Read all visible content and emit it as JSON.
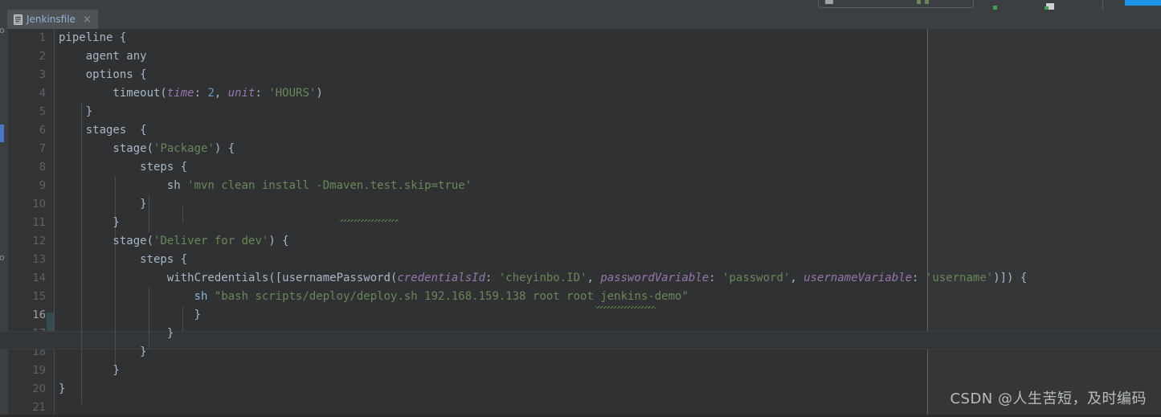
{
  "toolbar": {
    "run_config_placeholder": "",
    "icons": [
      "run-icon",
      "debug-icon",
      "settings-icon",
      "search-icon"
    ]
  },
  "tab": {
    "icon": "file-icon",
    "label": "Jenkinsfile",
    "close_label": "×"
  },
  "editor": {
    "current_line": 16,
    "line_numbers": [
      "1",
      "2",
      "3",
      "4",
      "5",
      "6",
      "7",
      "8",
      "9",
      "10",
      "11",
      "12",
      "13",
      "14",
      "15",
      "16",
      "17",
      "18",
      "19",
      "20",
      "21"
    ],
    "lines": [
      {
        "n": 1,
        "text": "pipeline {"
      },
      {
        "n": 2,
        "text": "    agent any"
      },
      {
        "n": 3,
        "text": "    options {"
      },
      {
        "n": 4,
        "text": "        timeout(time: 2, unit: 'HOURS')"
      },
      {
        "n": 5,
        "text": "    }"
      },
      {
        "n": 6,
        "text": "    stages  {"
      },
      {
        "n": 7,
        "text": "        stage('Package') {"
      },
      {
        "n": 8,
        "text": "            steps {"
      },
      {
        "n": 9,
        "text": "                sh 'mvn clean install -Dmaven.test.skip=true'"
      },
      {
        "n": 10,
        "text": "            }"
      },
      {
        "n": 11,
        "text": "        }"
      },
      {
        "n": 12,
        "text": "        stage('Deliver for dev') {"
      },
      {
        "n": 13,
        "text": "            steps {"
      },
      {
        "n": 14,
        "text": "                withCredentials([usernamePassword(credentialsId: 'cheyinbo.ID', passwordVariable: 'password', usernameVariable: 'username')]) {"
      },
      {
        "n": 15,
        "text": "                    sh \"bash scripts/deploy/deploy.sh 192.168.159.138 root root jenkins-demo\""
      },
      {
        "n": 16,
        "text": "                    }"
      },
      {
        "n": 17,
        "text": "                }"
      },
      {
        "n": 18,
        "text": "            }"
      },
      {
        "n": 19,
        "text": "        }"
      },
      {
        "n": 20,
        "text": "}"
      },
      {
        "n": 21,
        "text": ""
      }
    ],
    "tokens": {
      "line1": [
        "pipeline",
        " {"
      ],
      "line2": [
        "agent any"
      ],
      "line3": [
        "options {"
      ],
      "line4": [
        "timeout(",
        "time",
        ": ",
        "2",
        ", ",
        "unit",
        ": ",
        "'HOURS'",
        ")"
      ],
      "line6": [
        "stages  {"
      ],
      "line7": [
        "stage(",
        "'Package'",
        ") {"
      ],
      "line8": [
        "steps {"
      ],
      "line9": [
        "sh ",
        "'mvn clean install -Dmaven.test.skip=true'"
      ],
      "line12": [
        "stage(",
        "'Deliver for dev'",
        ") {"
      ],
      "line13": [
        "steps {"
      ],
      "line14": [
        "withCredentials([usernamePassword(",
        "credentialsId",
        ": ",
        "'cheyinbo.ID'",
        ", ",
        "passwordVariable",
        ": ",
        "'password'",
        ", ",
        "usernameVariable",
        ": ",
        "'username'",
        ")]) {"
      ],
      "line15": [
        "sh ",
        "\"bash scripts/deploy/deploy.sh 192.168.159.138 root root jenkins-demo\""
      ]
    },
    "inspection_warnings": [
      "Dmaven.test",
      "cheyinbo.ID"
    ],
    "colors": {
      "background": "#2f3133",
      "gutter": "#313335",
      "tabbar": "#3c3f41",
      "string": "#6a8759",
      "named_arg": "#9876aa",
      "number": "#6897bb",
      "keyword_sh": "#8fb3d9",
      "default_text": "#a9b7c6",
      "line_number": "#606366",
      "change_marker": "#4a77c4"
    }
  },
  "watermark": {
    "text": "CSDN @人生苦短，及时编码"
  }
}
